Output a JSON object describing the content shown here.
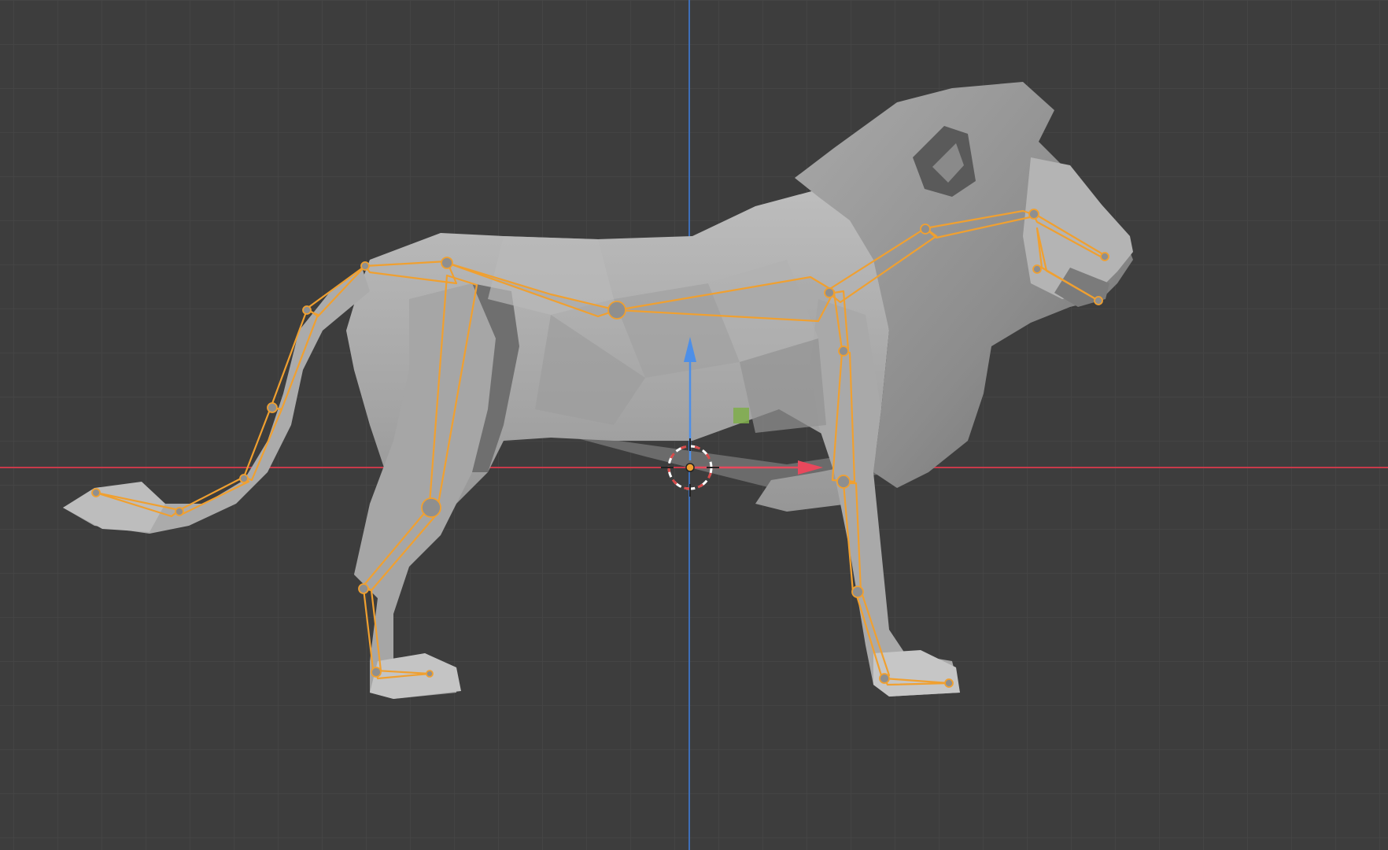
{
  "app": {
    "view": "3d-viewport",
    "mode": "object-mode"
  },
  "viewport": {
    "background_color": "#3d3d3d",
    "grid_minor_color": "#474747",
    "grid_major_color": "#555555",
    "x_axis_color": "#c93a4a",
    "z_axis_color": "#3e6fb8"
  },
  "scene_objects": [
    {
      "name": "lion-mesh",
      "type": "mesh",
      "color": "#9a9a9a"
    },
    {
      "name": "armature",
      "type": "armature",
      "selected": true,
      "color": "#f0a030"
    }
  ],
  "gizmo": {
    "x_arrow_color": "#e8485c",
    "z_arrow_color": "#4d8fe8",
    "origin_color": "#f0a030"
  },
  "light_marker": {
    "color": "#7fae4a"
  },
  "cursor_3d": {
    "ring_color_a": "#d84a4a",
    "ring_color_b": "#ffffff"
  }
}
